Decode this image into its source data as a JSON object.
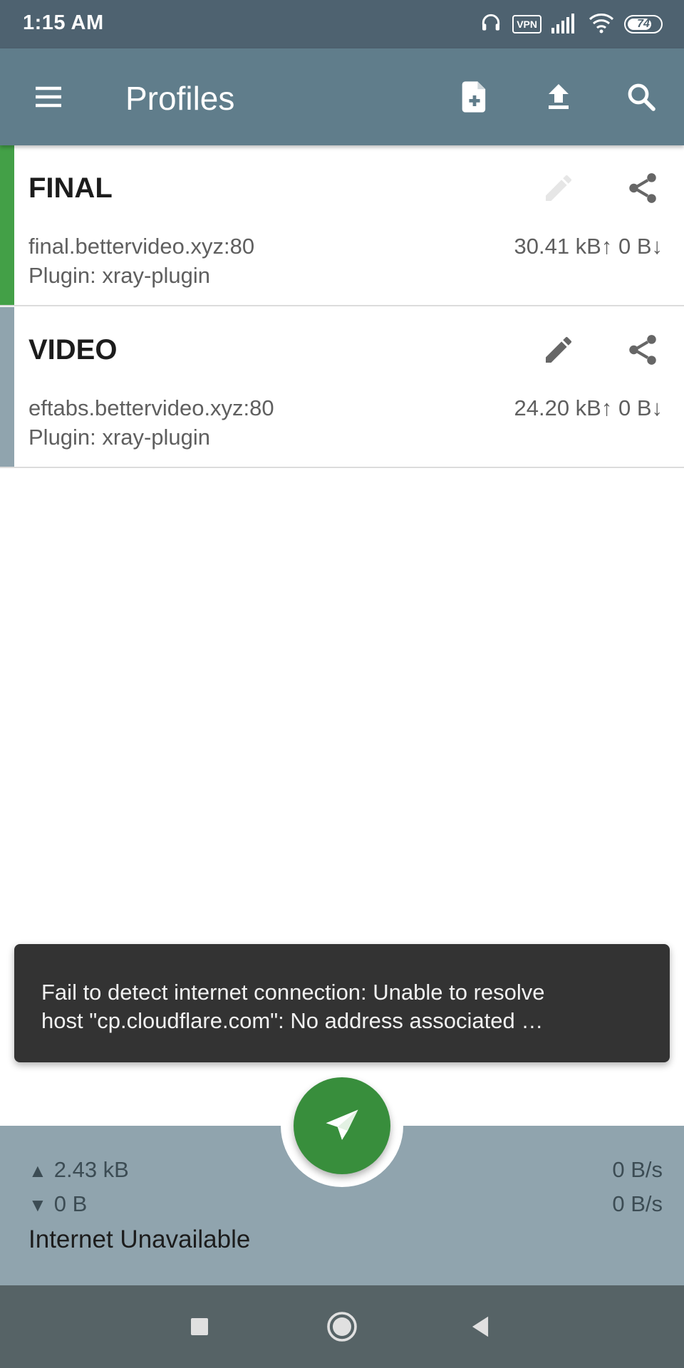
{
  "status_bar": {
    "time": "1:15 AM",
    "vpn_label": "VPN",
    "battery_level": 74,
    "battery_text": "74"
  },
  "toolbar": {
    "title": "Profiles"
  },
  "profiles": [
    {
      "name": "FINAL",
      "host": "final.bettervideo.xyz:80",
      "plugin": "Plugin: xray-plugin",
      "traffic": "30.41 kB↑ 0 B↓",
      "selected": true,
      "accent_color": "#43a047",
      "edit_enabled": false
    },
    {
      "name": "VIDEO",
      "host": "eftabs.bettervideo.xyz:80",
      "plugin": "Plugin: xray-plugin",
      "traffic": "24.20 kB↑ 0 B↓",
      "selected": false,
      "accent_color": "#90a4ae",
      "edit_enabled": true
    }
  ],
  "toast": {
    "line1": "Fail to detect internet connection: Unable to resolve",
    "line2": "host \"cp.cloudflare.com\": No address associated …"
  },
  "stats": {
    "tx_total": "2.43 kB",
    "rx_total": "0 B",
    "tx_rate": "0 B/s",
    "rx_rate": "0 B/s",
    "connection_status": "Internet Unavailable"
  },
  "colors": {
    "status_bar": "#4e6270",
    "toolbar": "#607d8b",
    "fab": "#388e3c",
    "bottom_bar": "#90a4ae",
    "nav_bar": "#566366",
    "toast": "#333333"
  }
}
